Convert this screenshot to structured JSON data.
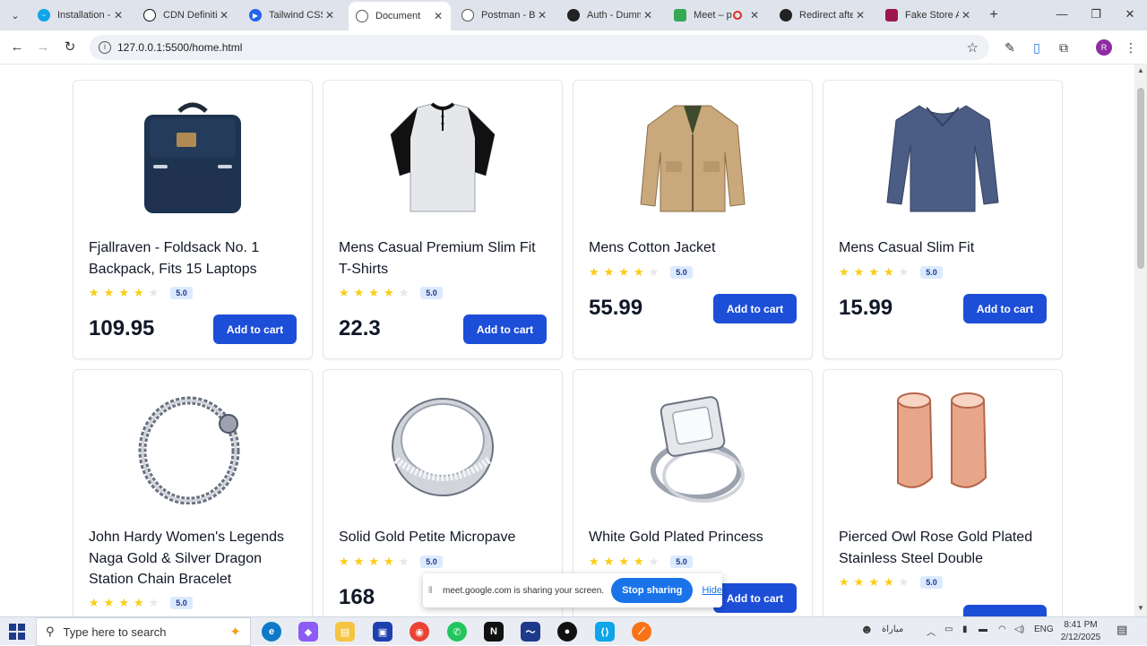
{
  "browser": {
    "tabs": [
      {
        "title": "Installation -",
        "favicon_color": "#0ea5e9",
        "active": false
      },
      {
        "title": "CDN Definiti",
        "favicon_color": "#111111",
        "active": false
      },
      {
        "title": "Tailwind CSS",
        "favicon_color": "#2563eb",
        "active": false
      },
      {
        "title": "Document",
        "favicon_color": "#555555",
        "active": true
      },
      {
        "title": "Postman - Br",
        "favicon_color": "#555555",
        "active": false
      },
      {
        "title": "Auth - Dumm",
        "favicon_color": "#222222",
        "active": false
      },
      {
        "title": "Meet – p",
        "favicon_color": "#34a853",
        "active": false
      },
      {
        "title": "Redirect afte",
        "favicon_color": "#222222",
        "active": false
      },
      {
        "title": "Fake Store A",
        "favicon_color": "#9d174d",
        "active": false
      }
    ],
    "url": "127.0.0.1:5500/home.html",
    "profile_initial": "R"
  },
  "products": [
    {
      "title": "Fjallraven - Foldsack No. 1 Backpack, Fits 15 Laptops",
      "rating": 4,
      "rating_label": "5.0",
      "price": "109.95",
      "button": "Add to cart",
      "image": "backpack"
    },
    {
      "title": "Mens Casual Premium Slim Fit T-Shirts",
      "rating": 4,
      "rating_label": "5.0",
      "price": "22.3",
      "button": "Add to cart",
      "image": "tshirt"
    },
    {
      "title": "Mens Cotton Jacket",
      "rating": 4,
      "rating_label": "5.0",
      "price": "55.99",
      "button": "Add to cart",
      "image": "jacket"
    },
    {
      "title": "Mens Casual Slim Fit",
      "rating": 4,
      "rating_label": "5.0",
      "price": "15.99",
      "button": "Add to cart",
      "image": "longsleeve"
    },
    {
      "title": "John Hardy Women's Legends Naga Gold & Silver Dragon Station Chain Bracelet",
      "rating": 4,
      "rating_label": "5.0",
      "price": "",
      "button": "",
      "image": "bracelet"
    },
    {
      "title": "Solid Gold Petite Micropave",
      "rating": 4,
      "rating_label": "5.0",
      "price": "168",
      "button": "",
      "image": "ring"
    },
    {
      "title": "White Gold Plated Princess",
      "rating": 4,
      "rating_label": "5.0",
      "price": "",
      "button": "Add to cart",
      "image": "diamond-ring"
    },
    {
      "title": "Pierced Owl Rose Gold Plated Stainless Steel Double",
      "rating": 4,
      "rating_label": "5.0",
      "price": "",
      "button": "",
      "image": "rose-rings"
    }
  ],
  "share_banner": {
    "message": "meet.google.com is sharing your screen.",
    "stop_label": "Stop sharing",
    "hide_label": "Hide"
  },
  "taskbar": {
    "search_placeholder": "Type here to search",
    "tray_language": "ENG",
    "tray_weather": "مباراة",
    "time": "8:41 PM",
    "date": "2/12/2025"
  },
  "colors": {
    "accent": "#1d4ed8",
    "star": "#facc15",
    "badge_bg": "#dbeafe"
  }
}
